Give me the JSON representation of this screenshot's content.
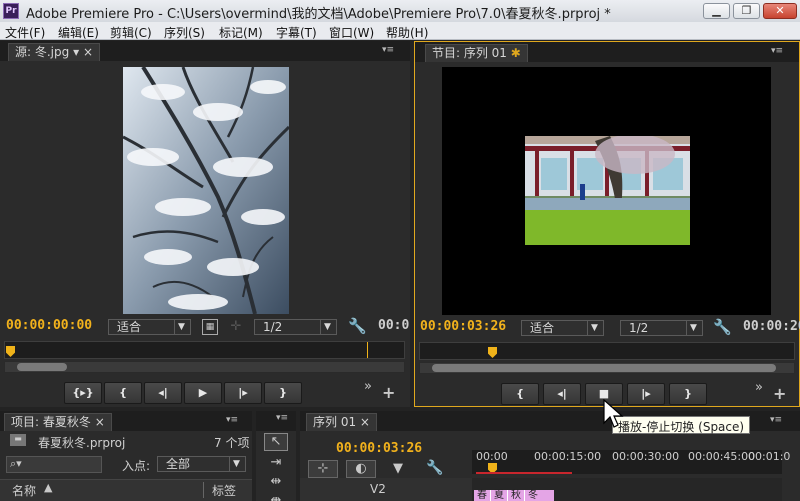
{
  "window": {
    "title": "Adobe Premiere Pro - C:\\Users\\overmind\\我的文档\\Adobe\\Premiere Pro\\7.0\\春夏秋冬.prproj *",
    "logo": "Pr",
    "min": "▁",
    "max": "❐",
    "close": "✕"
  },
  "menu": [
    "文件(F)",
    "编辑(E)",
    "剪辑(C)",
    "序列(S)",
    "标记(M)",
    "字幕(T)",
    "窗口(W)",
    "帮助(H)"
  ],
  "source": {
    "tab": "源: 冬.jpg",
    "tab_arrow": "▾",
    "close": "×",
    "menu": "▾≡",
    "timecode": "00:00:00:00",
    "fit": "适合",
    "res": "1/2",
    "end_tc": "00:0",
    "icons": [
      "camera-icon",
      "safe-margins-icon",
      "settings-icon"
    ],
    "controls": [
      "{▸}",
      "{",
      "◂|",
      "▶",
      "|▸",
      "}"
    ],
    "more": "»",
    "add": "+"
  },
  "program": {
    "tab": "节目: 序列 01",
    "menu": "▾≡",
    "timecode": "00:00:03:26",
    "fit": "适合",
    "res": "1/2",
    "end_tc": "00:00:20",
    "controls": [
      "{",
      "◂|",
      "■",
      "|▸",
      "}"
    ],
    "more": "»",
    "add": "+",
    "tooltip": "播放-停止切换 (Space)"
  },
  "project": {
    "tab": "项目: 春夏秋冬",
    "close": "×",
    "menu": "▾≡",
    "file": "春夏秋冬.prproj",
    "count": "7 个项",
    "search_placeholder": "",
    "search_icon": "⌕▾",
    "inpoint_label": "入点:",
    "inpoint_value": "全部",
    "col_name": "名称",
    "col_label": "标签"
  },
  "timeline": {
    "tab": "序列 01",
    "close": "×",
    "menu": "▾≡",
    "timecode": "00:00:03:26",
    "ruler": [
      "00:00",
      "00:00:15:00",
      "00:00:30:00",
      "00:00:45:00",
      "00:01:0"
    ],
    "track": "V2",
    "clip_labels": [
      "春",
      "夏",
      "秋",
      "冬"
    ]
  },
  "colors": {
    "accent": "#f2b21c",
    "panel_focus": "#e0a81e",
    "clip": "#e4a5e6"
  }
}
